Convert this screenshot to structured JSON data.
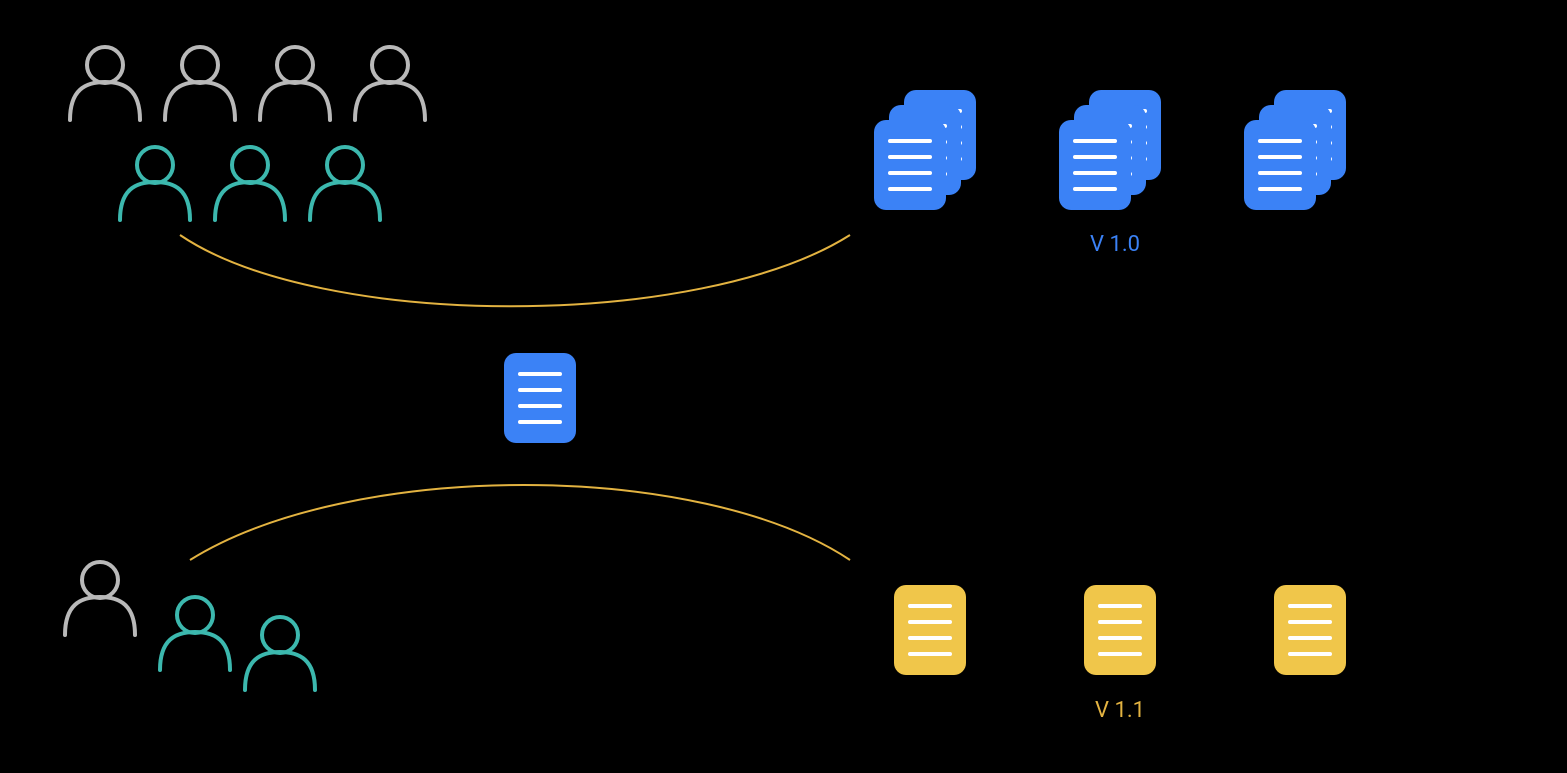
{
  "colors": {
    "gray": "#B9B9B9",
    "teal": "#3CB8AE",
    "blue": "#3B82F6",
    "yellow": "#F0C64A",
    "curve": "#E3B341",
    "white": "#FFFFFF"
  },
  "versions": {
    "v1_0": {
      "label": "V 1.0",
      "color": "#3B82F6"
    },
    "v1_1": {
      "label": "V 1.1",
      "color": "#E3B341"
    }
  },
  "people_groups": {
    "top_gray_row": {
      "count": 4,
      "color": "gray"
    },
    "top_teal_row": {
      "count": 3,
      "color": "teal"
    },
    "bottom_gray": {
      "count": 1,
      "color": "gray"
    },
    "bottom_teal": {
      "count": 2,
      "color": "teal"
    }
  },
  "documents": {
    "center_single": {
      "color": "blue"
    },
    "top_stacks": {
      "count": 3,
      "per_stack": 3,
      "color": "blue"
    },
    "bottom_singles": {
      "count": 3,
      "color": "yellow"
    }
  }
}
